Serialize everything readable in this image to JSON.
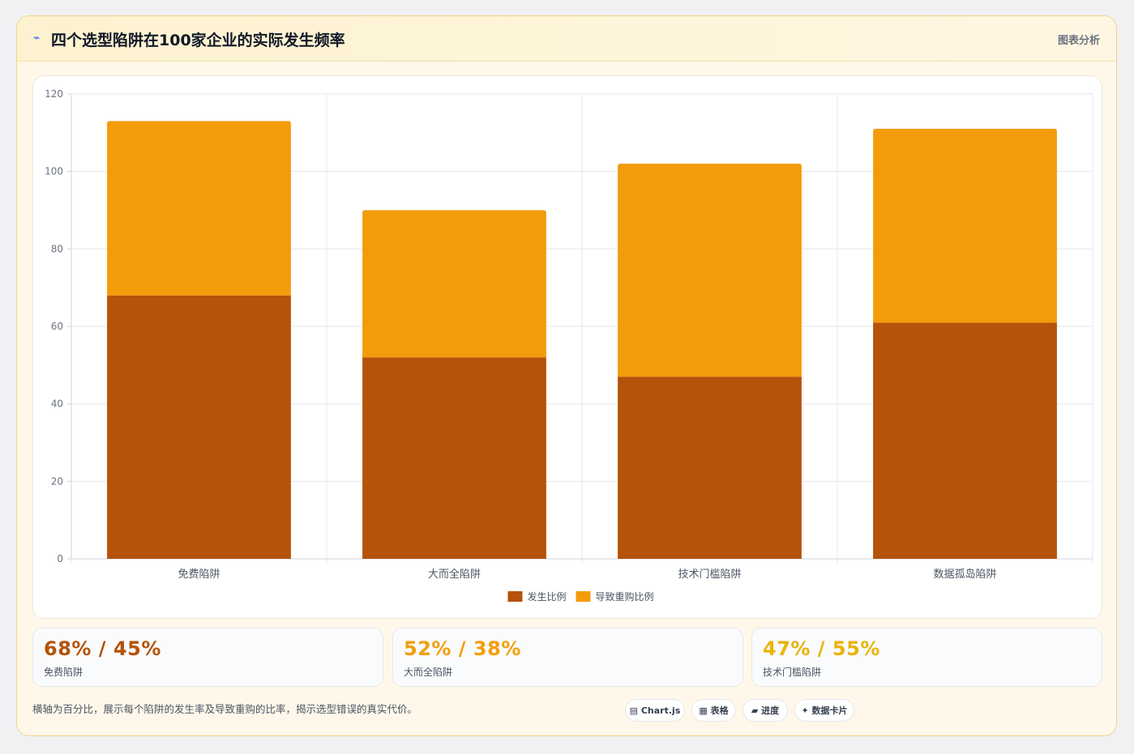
{
  "header": {
    "icon": "chart-trend-icon",
    "icon_glyph": "⌁",
    "title": "四个选型陷阱在100家企业的实际发生频率",
    "tag": "图表分析"
  },
  "chart_data": {
    "type": "bar",
    "stacked": true,
    "title": "",
    "xlabel": "",
    "ylabel": "",
    "categories": [
      "免费陷阱",
      "大而全陷阱",
      "技术门槛陷阱",
      "数据孤岛陷阱"
    ],
    "series": [
      {
        "name": "发生比例",
        "color": "#b45309",
        "values": [
          68,
          52,
          47,
          61
        ]
      },
      {
        "name": "导致重购比例",
        "color": "#f39c0b",
        "values": [
          45,
          38,
          55,
          50
        ]
      }
    ],
    "ylim": [
      0,
      120
    ],
    "yticks": [
      "0",
      "20",
      "40",
      "60",
      "80",
      "100",
      "120"
    ],
    "grid": true,
    "legend": "bottom"
  },
  "stats": [
    {
      "value": "68% / 45%",
      "label": "免费陷阱",
      "color": "#b45309"
    },
    {
      "value": "52% / 38%",
      "label": "大而全陷阱",
      "color": "#f59e0b"
    },
    {
      "value": "47% / 55%",
      "label": "技术门槛陷阱",
      "color": "#eab308"
    }
  ],
  "footnote": "横轴为百分比，展示每个陷阱的发生率及导致重购的比率，揭示选型错误的真实代价。",
  "chips": [
    {
      "icon": "chart-icon",
      "glyph": "▤",
      "label": "Chart.js"
    },
    {
      "icon": "table-icon",
      "glyph": "▦",
      "label": "表格"
    },
    {
      "icon": "progress-icon",
      "glyph": "▰",
      "label": "进度"
    },
    {
      "icon": "data-card-icon",
      "glyph": "✦",
      "label": "数据卡片"
    }
  ]
}
